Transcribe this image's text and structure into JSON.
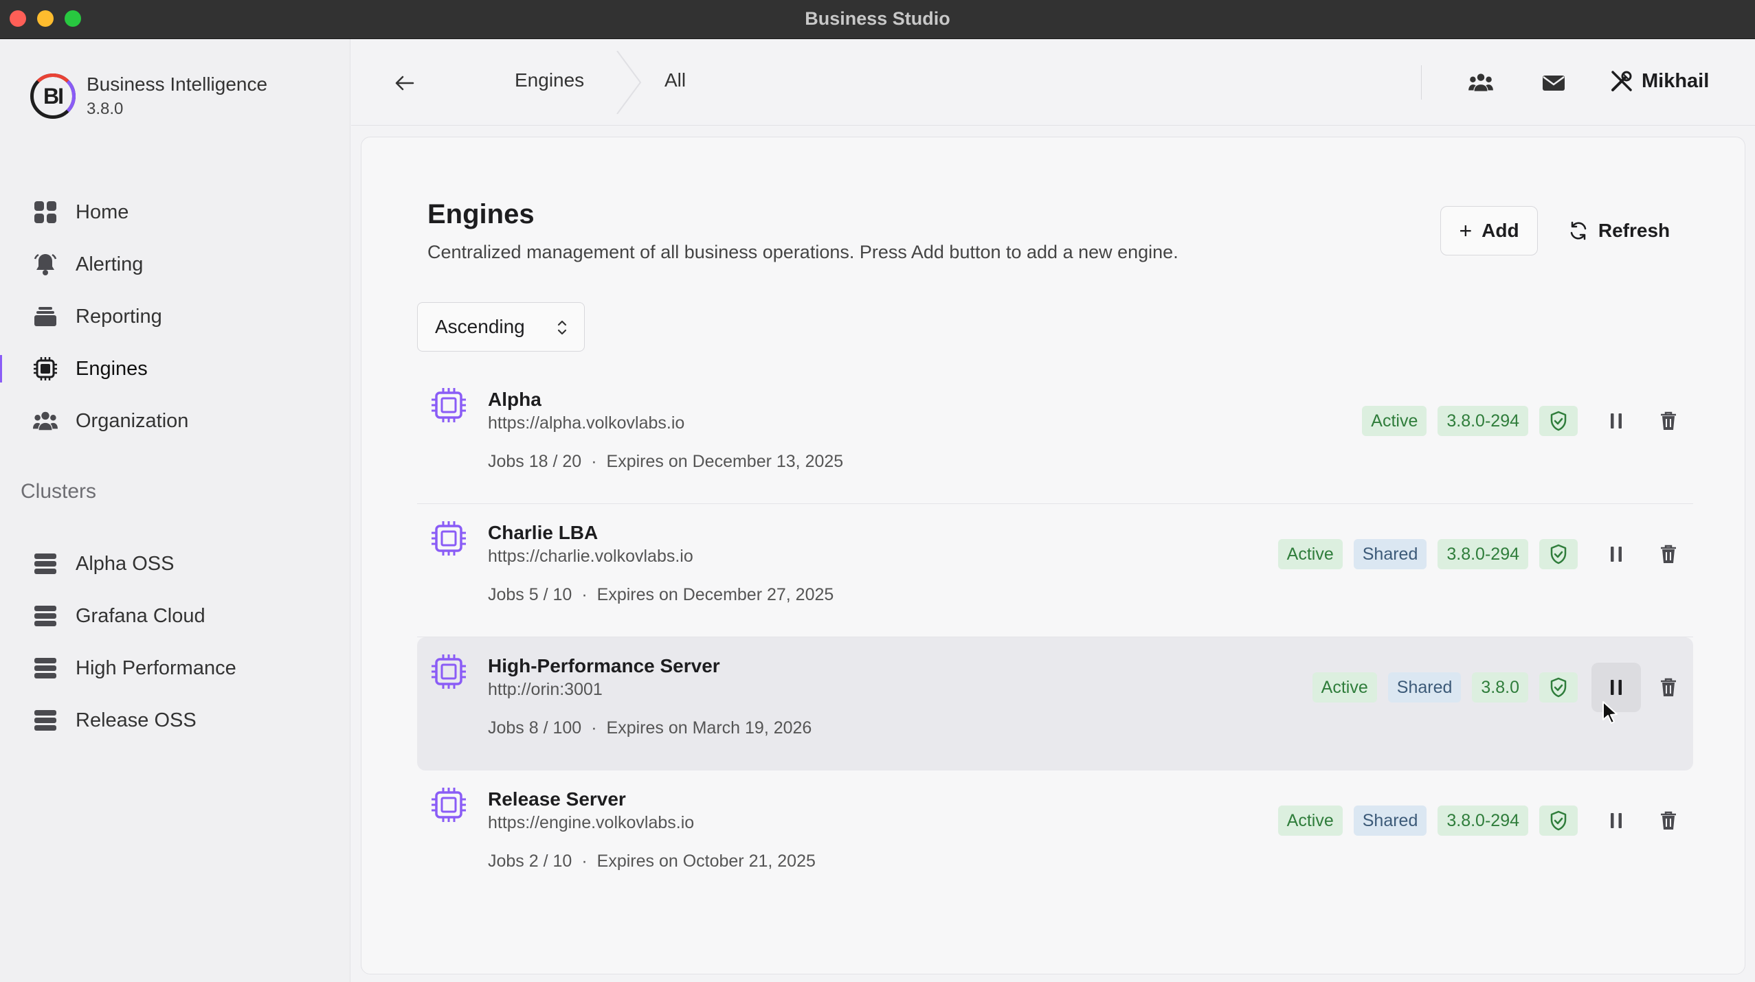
{
  "window": {
    "title": "Business Studio"
  },
  "brand": {
    "name": "Business Intelligence",
    "version": "3.8.0",
    "logo_text": "BI"
  },
  "sidebar": {
    "items": [
      {
        "label": "Home",
        "icon": "grid-icon"
      },
      {
        "label": "Alerting",
        "icon": "bell-icon"
      },
      {
        "label": "Reporting",
        "icon": "stack-icon"
      },
      {
        "label": "Engines",
        "icon": "chip-icon",
        "active": true
      },
      {
        "label": "Organization",
        "icon": "team-icon"
      }
    ],
    "clusters_label": "Clusters",
    "clusters": [
      {
        "label": "Alpha OSS",
        "icon": "server-icon"
      },
      {
        "label": "Grafana Cloud",
        "icon": "server-icon"
      },
      {
        "label": "High Performance",
        "icon": "server-icon"
      },
      {
        "label": "Release OSS",
        "icon": "server-icon"
      }
    ]
  },
  "header": {
    "breadcrumb": [
      "Engines",
      "All"
    ],
    "user_name": "Mikhail"
  },
  "main": {
    "title": "Engines",
    "description": "Centralized management of all business operations. Press Add button to add a new engine.",
    "add_label": "Add",
    "refresh_label": "Refresh",
    "sort_value": "Ascending",
    "engines": [
      {
        "name": "Alpha",
        "url": "https://alpha.volkovlabs.io",
        "jobs": "Jobs 18 / 20",
        "expires": "Expires on December 13, 2025",
        "status": "Active",
        "shared": "",
        "version": "3.8.0-294"
      },
      {
        "name": "Charlie LBA",
        "url": "https://charlie.volkovlabs.io",
        "jobs": "Jobs 5 / 10",
        "expires": "Expires on December 27, 2025",
        "status": "Active",
        "shared": "Shared",
        "version": "3.8.0-294"
      },
      {
        "name": "High-Performance Server",
        "url": "http://orin:3001",
        "jobs": "Jobs 8 / 100",
        "expires": "Expires on March 19, 2026",
        "status": "Active",
        "shared": "Shared",
        "version": "3.8.0"
      },
      {
        "name": "Release Server",
        "url": "https://engine.volkovlabs.io",
        "jobs": "Jobs 2 / 10",
        "expires": "Expires on October 21, 2025",
        "status": "Active",
        "shared": "Shared",
        "version": "3.8.0-294"
      }
    ],
    "meta_separator": "·"
  },
  "colors": {
    "accent": "#8a5cf6",
    "badge_green": "#2f7d3b",
    "badge_blue": "#3c5a78"
  }
}
